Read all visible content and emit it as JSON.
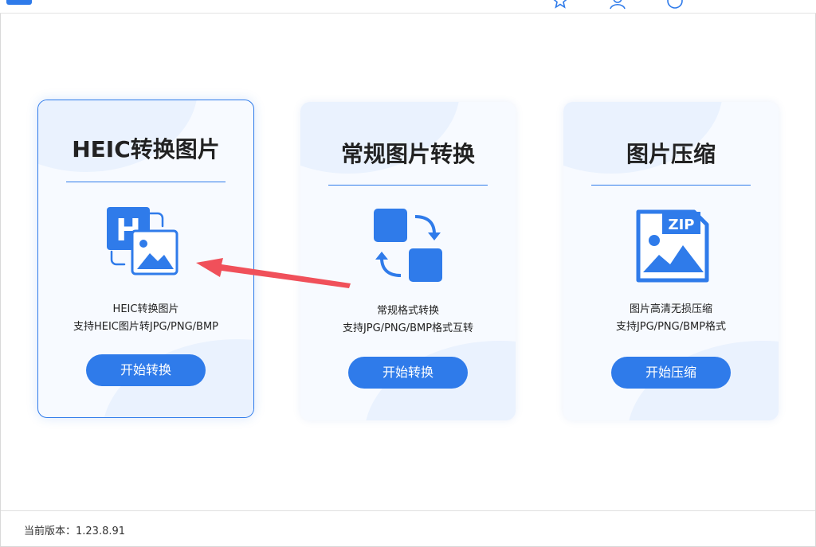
{
  "cards": [
    {
      "title": "HEIC转换图片",
      "desc_line1": "HEIC转换图片",
      "desc_line2": "支持HEIC图片转JPG/PNG/BMP",
      "button": "开始转换",
      "icon": "heic-convert-icon"
    },
    {
      "title": "常规图片转换",
      "desc_line1": "常规格式转换",
      "desc_line2": "支持JPG/PNG/BMP格式互转",
      "button": "开始转换",
      "icon": "format-swap-icon"
    },
    {
      "title": "图片压缩",
      "desc_line1": "图片高清无损压缩",
      "desc_line2": "支持JPG/PNG/BMP格式",
      "button": "开始压缩",
      "icon": "zip-image-icon"
    }
  ],
  "zip_badge": "ZIP",
  "heic_badge": "H",
  "footer": {
    "version": "当前版本：1.23.8.91"
  },
  "colors": {
    "accent": "#2f7bea",
    "annotation_arrow": "#f0505a"
  }
}
